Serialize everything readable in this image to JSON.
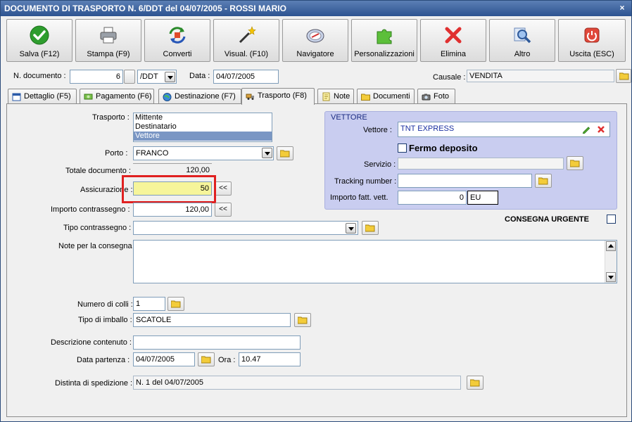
{
  "window": {
    "title": "DOCUMENTO DI TRASPORTO N. 6/DDT del 04/07/2005 - ROSSI MARIO",
    "close_glyph": "×"
  },
  "toolbar": [
    {
      "label": "Salva (F12)",
      "icon": "check-icon"
    },
    {
      "label": "Stampa (F9)",
      "icon": "printer-icon"
    },
    {
      "label": "Converti",
      "icon": "convert-icon"
    },
    {
      "label": "Visual. (F10)",
      "icon": "magic-wand-icon"
    },
    {
      "label": "Navigatore",
      "icon": "compass-icon"
    },
    {
      "label": "Personalizzazioni",
      "icon": "puzzle-icon"
    },
    {
      "label": "Elimina",
      "icon": "delete-x-icon"
    },
    {
      "label": "Altro",
      "icon": "magnifier-icon"
    },
    {
      "label": "Uscita (ESC)",
      "icon": "power-icon"
    }
  ],
  "header": {
    "num_label": "N. documento :",
    "num_value": "6",
    "series_value": "/DDT",
    "date_label": "Data :",
    "date_value": "04/07/2005",
    "causale_label": "Causale :",
    "causale_value": "VENDITA"
  },
  "tabs": [
    "Dettaglio (F5)",
    "Pagamento (F6)",
    "Destinazione (F7)",
    "Trasporto (F8)",
    "Note",
    "Documenti",
    "Foto"
  ],
  "active_tab": "Trasporto (F8)",
  "form": {
    "trasporto_label": "Trasporto :",
    "trasporto_options": [
      "Mittente",
      "Destinatario",
      "Vettore"
    ],
    "trasporto_selected": "Vettore",
    "porto_label": "Porto :",
    "porto_value": "FRANCO",
    "totale_label": "Totale documento :",
    "totale_value": "120,00",
    "assicurazione_label": "Assicurazione :",
    "assicurazione_value": "50",
    "contrassegno_label": "Importo contrassegno :",
    "contrassegno_value": "120,00",
    "shift_glyph": "<<",
    "tipo_contrassegno_label": "Tipo contrassegno :",
    "tipo_contrassegno_value": "",
    "note_label": "Note per la consegna",
    "note_value": "",
    "colli_label": "Numero di colli :",
    "colli_value": "1",
    "imballo_label": "Tipo di imballo :",
    "imballo_value": "SCATOLE",
    "descrizione_label": "Descrizione contenuto :",
    "descrizione_value": "",
    "partenza_label": "Data partenza :",
    "partenza_value": "04/07/2005",
    "ora_label": "Ora :",
    "ora_value": "10.47",
    "distinta_label": "Distinta di spedizione :",
    "distinta_value": "N.  1 del 04/07/2005"
  },
  "vettore": {
    "group_title": "VETTORE",
    "vettore_label": "Vettore :",
    "vettore_value": "TNT EXPRESS",
    "fermo_label": "Fermo deposito",
    "fermo_checked": false,
    "servizio_label": "Servizio :",
    "servizio_value": "",
    "tracking_label": "Tracking number :",
    "tracking_value": "",
    "importo_label": "Importo fatt. vett.",
    "importo_value": "0",
    "currency_value": "EU"
  },
  "urgente": {
    "label": "CONSEGNA URGENTE",
    "checked": false
  },
  "colors": {
    "title_bar": "#2d5390",
    "vettore_panel": "#c9cdf0",
    "highlight": "#e02020",
    "assicurazione_bg": "#f6f59a",
    "link_text": "#1a2fa0"
  }
}
